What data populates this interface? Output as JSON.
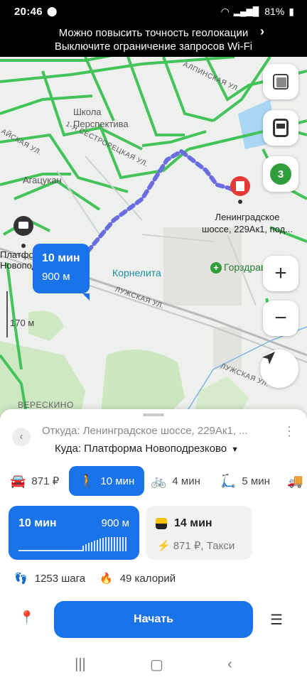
{
  "status": {
    "time": "20:46",
    "battery": "81%",
    "icons": [
      "location-icon",
      "wifi-icon",
      "volte-icon",
      "signal-icon",
      "battery-icon"
    ]
  },
  "banner": {
    "line1": "Можно повысить точность геолокации",
    "line2": "Выключите ограничение запросов Wi-Fi"
  },
  "map": {
    "labels": {
      "school": "Школа\nПерспектива",
      "agatsukan": "Агацукан",
      "destination": "Ленинградское\nшоссе, 229Ак1, под...",
      "platform": "Платформа\nНовоподрезково",
      "kornelita": "Корнелита",
      "gorzdrav": "Горздрав",
      "scale": "170 м",
      "vereskino": "ВЕРЕСКИНО"
    },
    "streets": {
      "sestroretskaya": "1-Я СЕСТРОРЕЦКАЯ УЛ.",
      "luzhskaya": "ЛУЖСКАЯ УЛ.",
      "luzhskaya2": "ЛУЖСКАЯ УЛ.",
      "alpinskaya": "АЛПИНСКАЯ УЛ.",
      "sestroretskaya_left": "АЙСКАЯ УЛ."
    },
    "bubble": {
      "time": "10 мин",
      "distance": "900 м"
    },
    "colors": {
      "route": "#6a6de0",
      "roads": "#44c35a",
      "primary": "#1a73e8",
      "dest": "#e53935"
    },
    "layers_badge": "3"
  },
  "sheet": {
    "from": "Откуда: Ленинградское шоссе, 229Ак1, ...",
    "to": "Куда: Платформа Новоподрезково",
    "modes": [
      {
        "icon": "car-icon",
        "label": "871 ₽"
      },
      {
        "icon": "walk-icon",
        "label": "10 мин",
        "active": true
      },
      {
        "icon": "bike-icon",
        "label": "4 мин"
      },
      {
        "icon": "scooter-icon",
        "label": "5 мин"
      }
    ],
    "walk_card": {
      "time": "10 мин",
      "distance": "900 м"
    },
    "taxi_card": {
      "time": "14 мин",
      "price": "871 ₽, Такси"
    },
    "steps": "1253 шага",
    "calories": "49 калорий",
    "start_button": "Начать"
  }
}
